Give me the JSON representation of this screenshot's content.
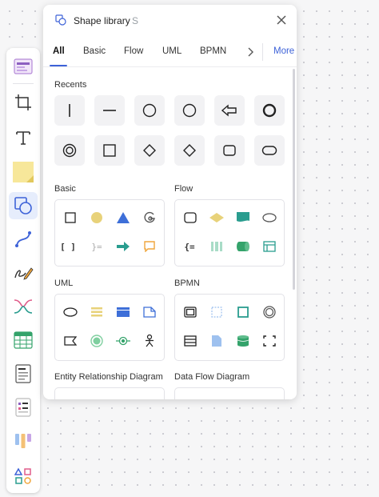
{
  "panel": {
    "title": "Shape library",
    "shortcut": "S",
    "icon": "shape-library-icon",
    "accent": "#3d62d8"
  },
  "tabs": [
    {
      "label": "All",
      "active": true
    },
    {
      "label": "Basic"
    },
    {
      "label": "Flow"
    },
    {
      "label": "UML"
    },
    {
      "label": "BPMN"
    }
  ],
  "more_label": "More",
  "sections": {
    "recents": "Recents",
    "basic": "Basic",
    "flow": "Flow",
    "uml": "UML",
    "bpmn": "BPMN",
    "erd": "Entity Relationship Diagram",
    "dfd": "Data Flow Diagram"
  },
  "recents": [
    "vertical-line",
    "horizontal-line",
    "circle",
    "circle-large",
    "left-arrow",
    "circle-bold",
    "double-circle",
    "square",
    "diamond",
    "diamond-large",
    "rounded-rect",
    "stadium"
  ],
  "basic_shapes": [
    "square",
    "yellow-circle",
    "blue-triangle",
    "arc",
    "brackets",
    "brace-lines",
    "teal-arrow",
    "speech-bubble"
  ],
  "basic_texts": {
    "brackets": "[ ]",
    "brace": "}="
  },
  "flow_shapes": [
    "rounded-rect",
    "yellow-diamond",
    "teal-document",
    "ellipse",
    "brace-equals",
    "striped-bar",
    "green-cylinder",
    "table-frame"
  ],
  "flow_texts": {
    "brace_eq": "{="
  },
  "uml_shapes": [
    "ellipse",
    "yellow-lines",
    "blue-window",
    "folded-note",
    "flag",
    "green-target",
    "port-circle",
    "actor"
  ],
  "bpmn_shapes": [
    "double-square",
    "dashed-square",
    "teal-square",
    "double-circle",
    "lines-box",
    "blue-document",
    "green-database",
    "dashed-corners"
  ],
  "toolbar": [
    "frame-template-icon",
    "crop-frame-icon",
    "text-icon",
    "sticky-note-icon",
    "shape-icon",
    "connector-icon",
    "pen-icon",
    "mindmap-icon",
    "table-icon",
    "doc-icon",
    "list-icon",
    "kanban-icon",
    "apps-icon"
  ],
  "colors": {
    "yellow": "#e8d27a",
    "blue": "#3e6fd8",
    "teal": "#2a9d8f",
    "green": "#34a36b",
    "orange": "#f0a63c",
    "light_blue": "#9ec1ef"
  }
}
